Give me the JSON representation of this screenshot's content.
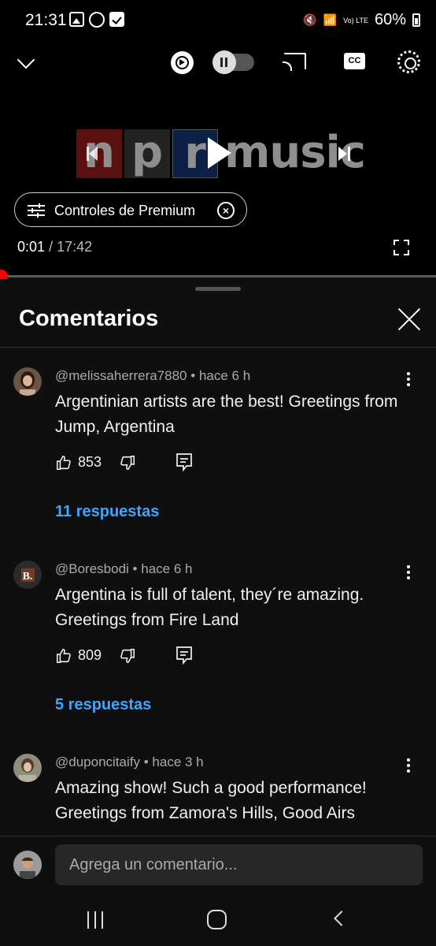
{
  "status_bar": {
    "time": "21:31",
    "battery": "60%",
    "network": "Vo) LTE"
  },
  "player": {
    "video_logo": {
      "letters": [
        "n",
        "p",
        "r"
      ],
      "word": "music"
    },
    "premium_chip": "Controles de Premium",
    "current_time": "0:01",
    "separator": "/",
    "duration": "17:42",
    "progress_fraction": 0.001,
    "icons": [
      "chevron-down-icon",
      "autoplay-icon",
      "pause-toggle-icon",
      "cast-icon",
      "captions-icon",
      "settings-icon",
      "previous-icon",
      "play-icon",
      "next-icon",
      "sliders-icon",
      "close-circle-icon",
      "fullscreen-icon"
    ]
  },
  "comments": {
    "title": "Comentarios",
    "items": [
      {
        "author": "@melissaherrera7880",
        "dot": "•",
        "time": "hace 6 h",
        "text": "Argentinian artists are the best! Greetings from Jump, Argentina",
        "likes": "853",
        "replies": "11 respuestas"
      },
      {
        "author": "@Boresbodi",
        "dot": "•",
        "time": "hace 6 h",
        "text": "Argentina is full of talent, they´re amazing. Greetings from Fire Land",
        "likes": "809",
        "replies": "5 respuestas",
        "avatar_letter": "B."
      },
      {
        "author": "@duponcitaify",
        "dot": "•",
        "time": "hace 3 h",
        "text": "Amazing show! Such a good performance! Greetings from Zamora's Hills, Good Airs"
      }
    ]
  },
  "composer": {
    "placeholder": "Agrega un comentario..."
  },
  "colors": {
    "accent_red": "#ff0000",
    "link_blue": "#3ea6ff",
    "background": "#0f0f0f"
  }
}
